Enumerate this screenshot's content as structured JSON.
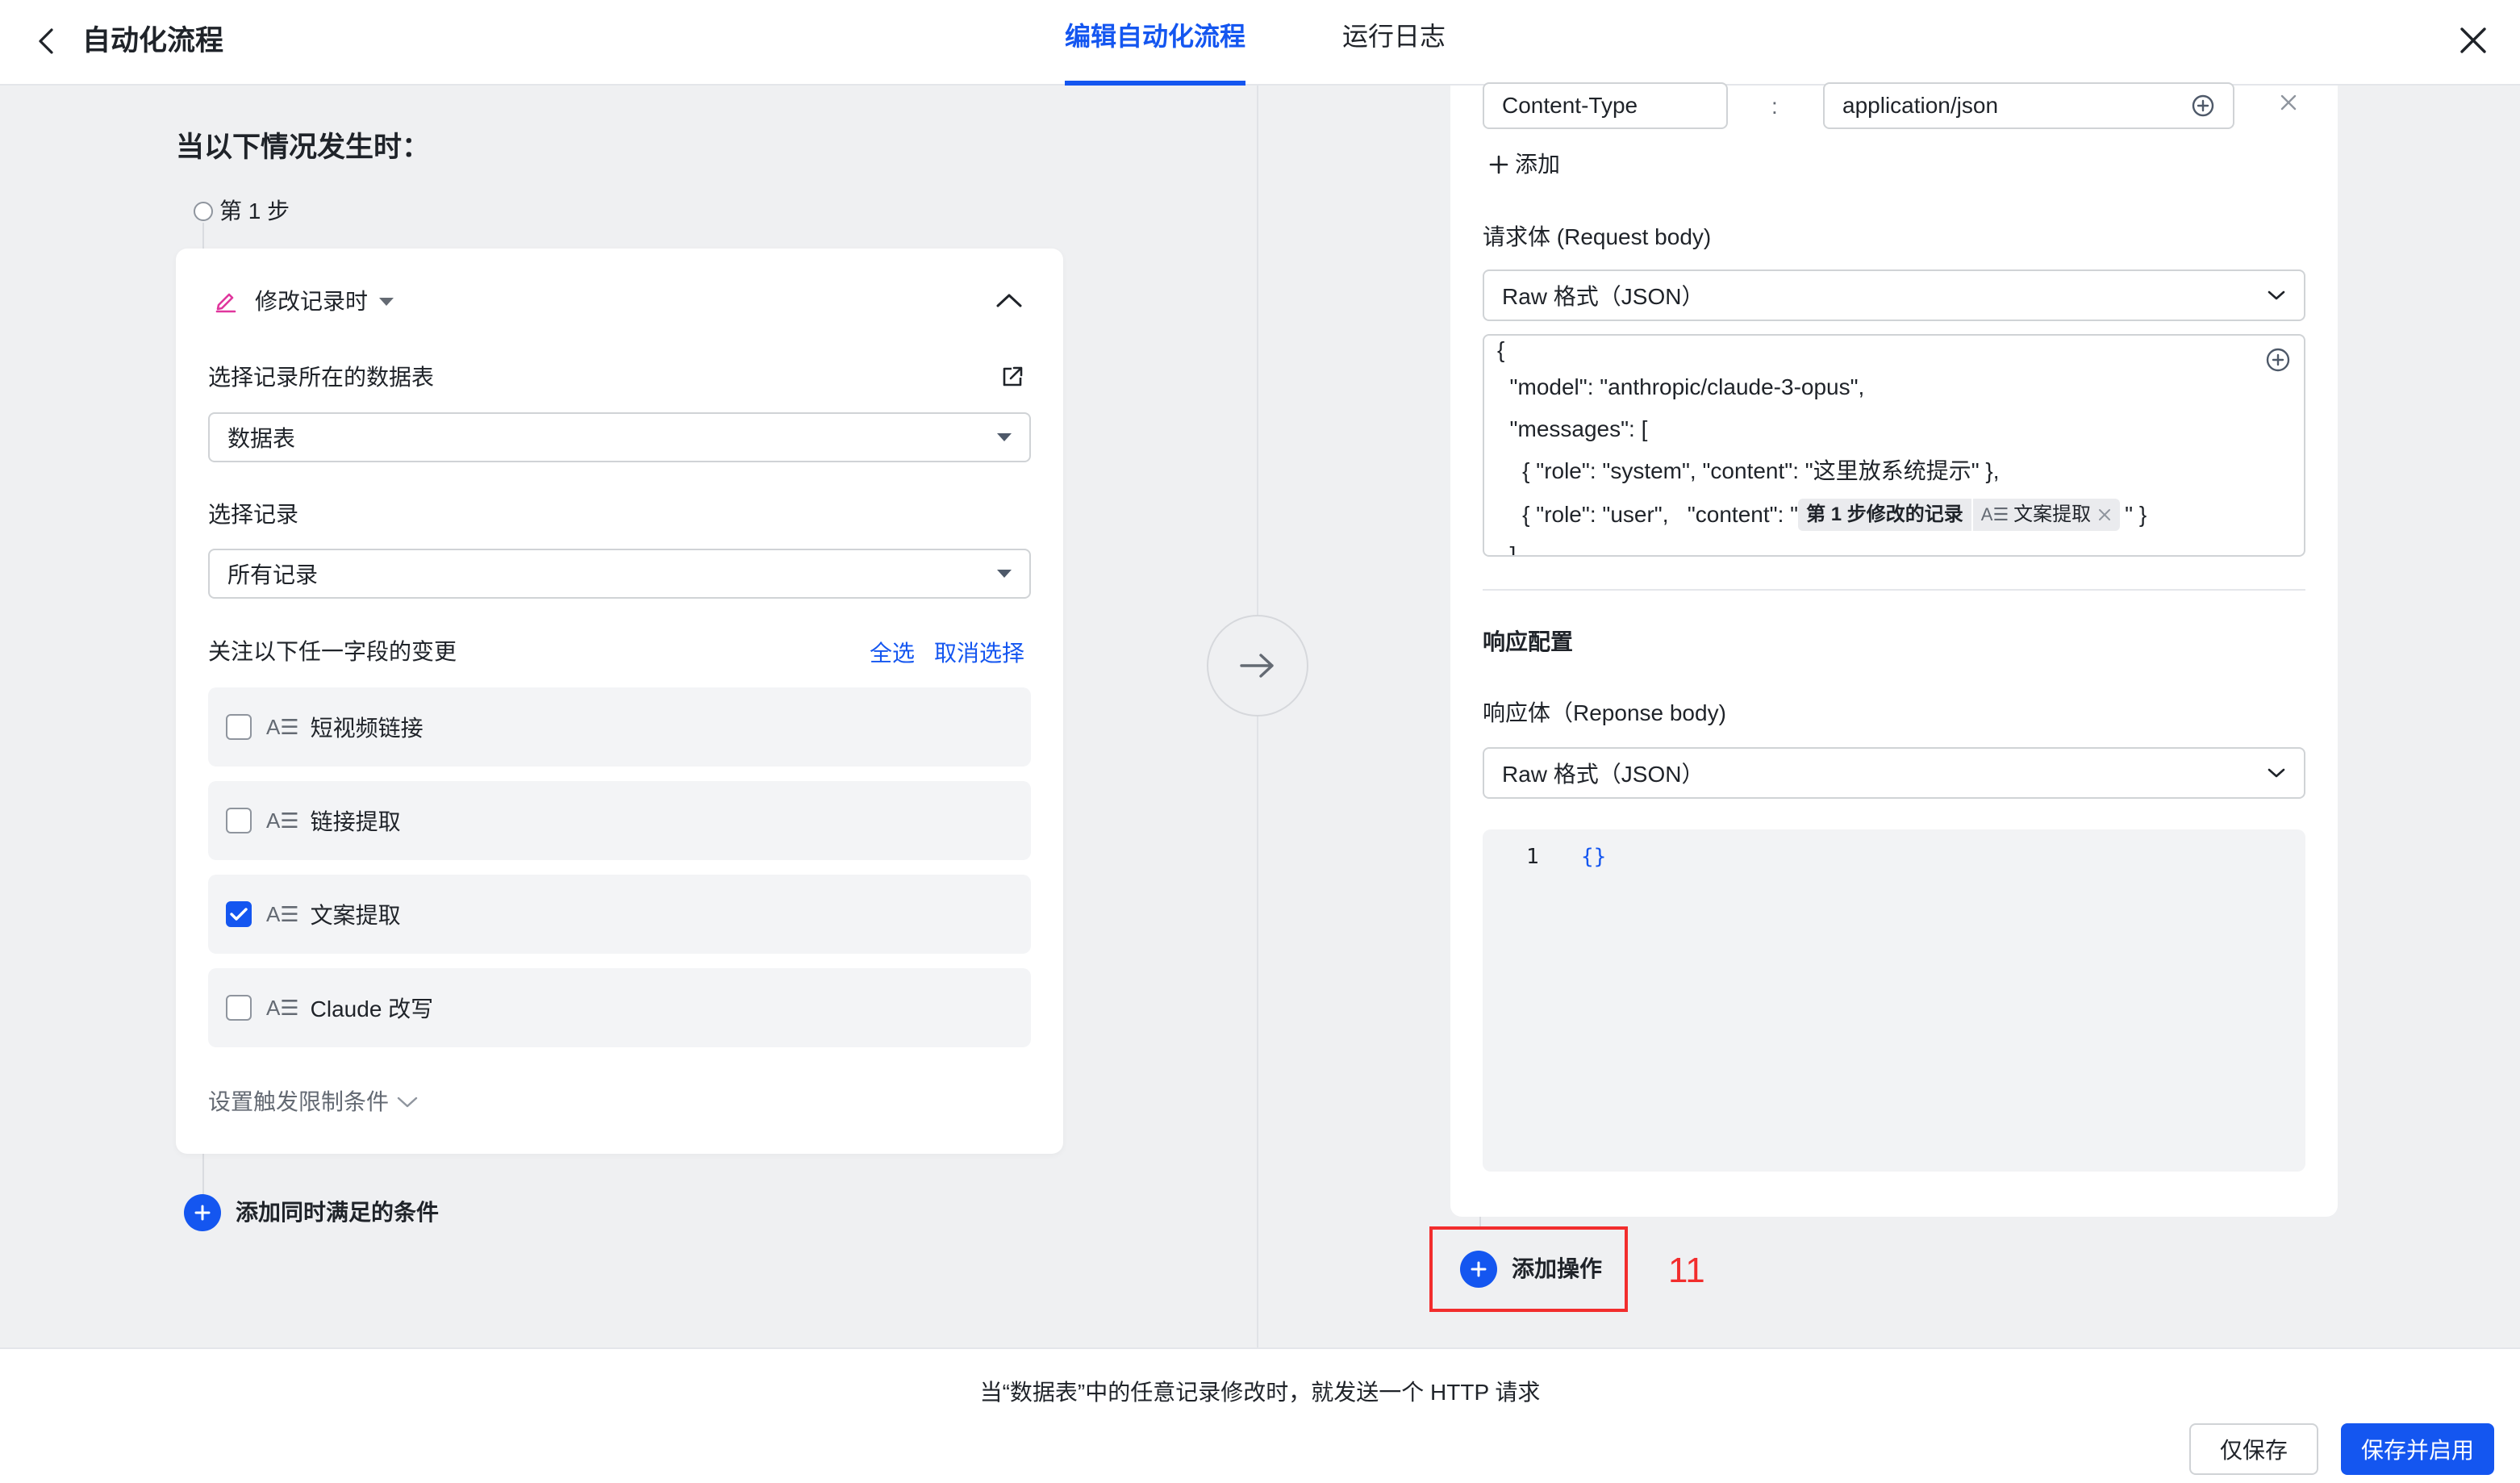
{
  "header": {
    "title": "自动化流程",
    "tabs": [
      {
        "label": "编辑自动化流程",
        "active": true
      },
      {
        "label": "运行日志",
        "active": false
      }
    ]
  },
  "trigger": {
    "heading": "当以下情况发生时：",
    "step_label": "第 1 步",
    "event": "修改记录时",
    "table_label": "选择记录所在的数据表",
    "table_value": "数据表",
    "record_label": "选择记录",
    "record_value": "所有记录",
    "watch_label": "关注以下任一字段的变更",
    "select_all": "全选",
    "deselect": "取消选择",
    "fields": [
      {
        "name": "短视频链接",
        "checked": false
      },
      {
        "name": "链接提取",
        "checked": false
      },
      {
        "name": "文案提取",
        "checked": true
      },
      {
        "name": "Claude 改写",
        "checked": false
      }
    ],
    "limit_label": "设置触发限制条件",
    "add_condition": "添加同时满足的条件"
  },
  "action": {
    "header_key": "Content-Type",
    "header_sep": ":",
    "header_value": "application/json",
    "add_label": "添加",
    "body_label": "请求体 (Request body)",
    "body_format": "Raw 格式（JSON）",
    "json": {
      "line1": "{",
      "line2": "  \"model\": \"anthropic/claude-3-opus\",",
      "line3": "  \"messages\": [",
      "line4": "    { \"role\": \"system\", \"content\": \"这里放系统提示\" },",
      "line5_prefix": "    { \"role\": \"user\",   \"content\": \"",
      "chip_step": "第 1 步修改的记录",
      "chip_field": "文案提取",
      "line5_suffix": "\" }",
      "line6": "  ]"
    },
    "response_heading": "响应配置",
    "response_label": "响应体（Reponse body)",
    "response_format": "Raw 格式（JSON）",
    "code_line_no": "1",
    "code_text": "{}",
    "add_action": "添加操作",
    "annotation": "11"
  },
  "footer": {
    "summary": "当“数据表”中的任意记录修改时，就发送一个 HTTP 请求",
    "save": "仅保存",
    "save_run": "保存并启用"
  },
  "colors": {
    "accent": "#1456f0",
    "highlight": "#f22d2d",
    "pencil": "#e0369d"
  }
}
